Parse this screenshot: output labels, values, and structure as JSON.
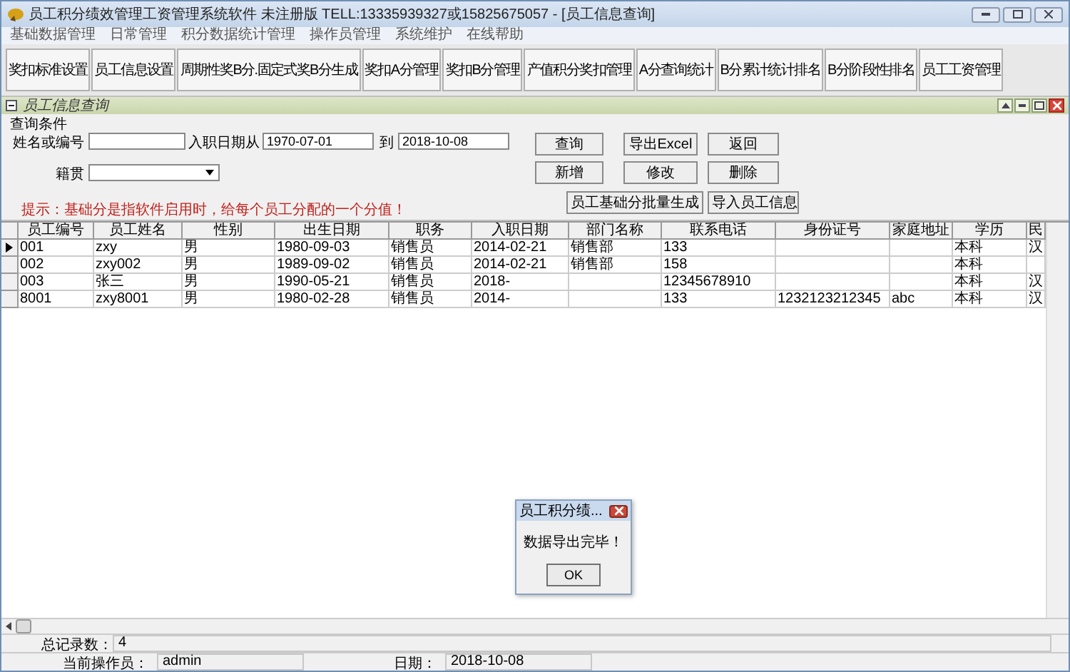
{
  "window": {
    "title": "员工积分绩效管理工资管理系统软件 未注册版 TELL:13335939327或15825675057 - [员工信息查询]"
  },
  "menu": [
    "基础数据管理",
    "日常管理",
    "积分数据统计管理",
    "操作员管理",
    "系统维护",
    "在线帮助"
  ],
  "toolbar": [
    "奖扣标准设置",
    "员工信息设置",
    "周期性奖B分.固定式奖B分生成",
    "奖扣A分管理",
    "奖扣B分管理",
    "产值积分奖扣管理",
    "A分查询统计",
    "B分累计统计排名",
    "B分阶段性排名",
    "员工工资管理"
  ],
  "child_window": {
    "title": "员工信息查询"
  },
  "query": {
    "group_title": "查询条件",
    "name_label": "姓名或编号",
    "date_from_label": "入职日期从",
    "date_from": "1970-07-01",
    "date_to_label": "到",
    "date_to": "2018-10-08",
    "origin_label": "籍贯",
    "buttons": [
      "查询",
      "导出Excel",
      "返回",
      "新增",
      "修改",
      "删除",
      "员工基础分批量生成",
      "导入员工信息"
    ],
    "hint": "提示：基础分是指软件启用时，给每个员工分配的一个分值！"
  },
  "table": {
    "columns": [
      "员工编号",
      "员工姓名",
      "性别",
      "出生日期",
      "职务",
      "入职日期",
      "部门名称",
      "联系电话",
      "身份证号",
      "家庭地址",
      "学历",
      "民"
    ],
    "rows": [
      {
        "selected": true,
        "cells": [
          "001",
          "zxy",
          "男",
          "1980-09-03",
          "销售员",
          "2014-02-21",
          "销售部",
          "133",
          null,
          null,
          "本科",
          "汉"
        ]
      },
      {
        "selected": false,
        "cells": [
          "002",
          "zxy002",
          "男",
          "1989-09-02",
          "销售员",
          "2014-02-21",
          "销售部",
          "158",
          null,
          null,
          "本科",
          null
        ]
      },
      {
        "selected": false,
        "cells": [
          "003",
          "张三",
          "男",
          "1990-05-21",
          "销售员",
          "2018-",
          null,
          "12345678910",
          null,
          null,
          "本科",
          "汉"
        ]
      },
      {
        "selected": false,
        "cells": [
          "8001",
          "zxy8001",
          "男",
          "1980-02-28",
          "销售员",
          "2014-",
          null,
          "133",
          "1232123212345",
          "abc",
          "本科",
          "汉"
        ]
      }
    ]
  },
  "dialog": {
    "title": "员工积分绩...",
    "message": "数据导出完毕！",
    "button": "OK"
  },
  "status_bar": {
    "count_label": "总记录数：",
    "count": "4",
    "operator_label": "当前操作员：",
    "operator": "admin",
    "date_label": "日期：",
    "date": "2018-10-08"
  }
}
